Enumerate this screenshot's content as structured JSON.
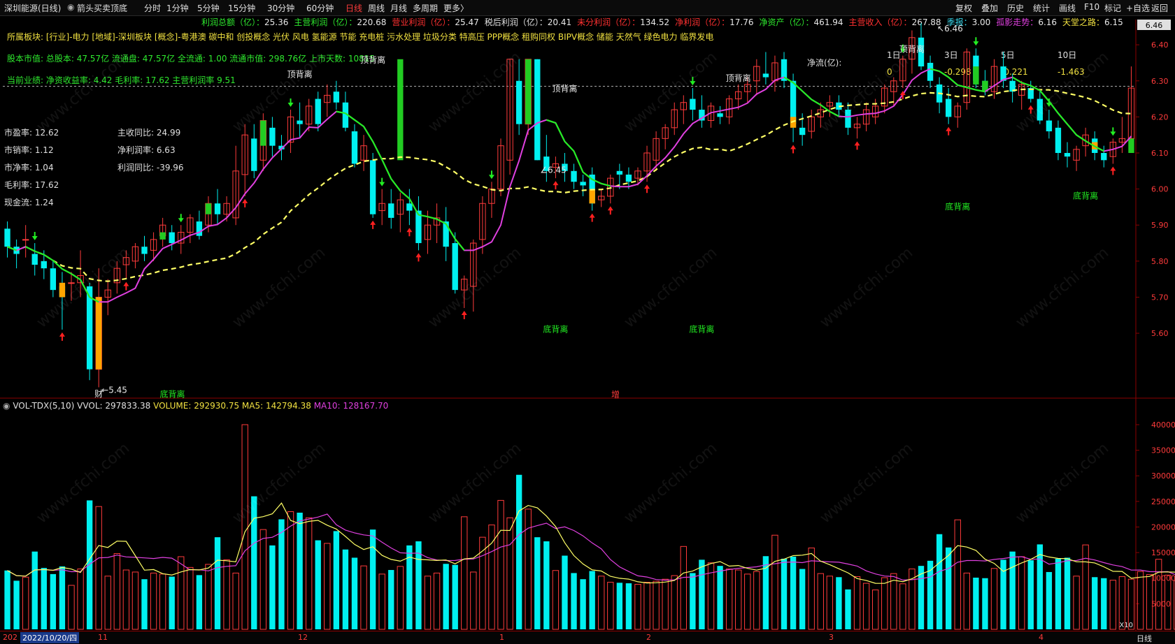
{
  "header": {
    "stock": "深圳能源(日线)",
    "indicator": "箭头买卖顶底",
    "menu": [
      "分时",
      "1分钟",
      "5分钟",
      "15分钟",
      "30分钟",
      "60分钟",
      "日线",
      "周线",
      "月线",
      "多周期",
      "更多〉"
    ],
    "active_index": 6,
    "right_buttons": [
      "复权",
      "叠加",
      "历史",
      "统计",
      "画线",
      "F10",
      "标记",
      "+自选",
      "返回"
    ]
  },
  "finance_line": [
    {
      "label": "利润总额（亿）：",
      "value": "25.36",
      "color": "#2ee82e"
    },
    {
      "label": "主营利润（亿）：",
      "value": "220.68",
      "color": "#2ee82e"
    },
    {
      "label": "营业利润（亿）：",
      "value": "25.47",
      "color": "#ff3030"
    },
    {
      "label": "税后利润（亿）：",
      "value": "20.41",
      "color": "#e0e0e0"
    },
    {
      "label": "未分利润（亿）：",
      "value": "134.52",
      "color": "#ff3030"
    },
    {
      "label": "净利润（亿）：",
      "value": "17.76",
      "color": "#ff3030"
    },
    {
      "label": "净资产（亿）：",
      "value": "461.94",
      "color": "#2ee82e"
    },
    {
      "label": "主营收入（亿）：",
      "value": "267.88",
      "color": "#ff3030"
    },
    {
      "label": "季报：",
      "value": "3.00",
      "color": "#37d4e8"
    },
    {
      "label": "孤影走势：",
      "value": "6.16",
      "color": "#e040e0"
    },
    {
      "label": "天堂之路：",
      "value": "6.15",
      "color": "#f0e040"
    }
  ],
  "sector_line": "所属板块: [行业]-电力 [地域]-深圳板块 [概念]-粤港澳 碳中和 创投概念 光伏 风电 氢能源 节能 充电桩 污水处理 垃圾分类 特高压 PPP概念 租购同权 BIPV概念 储能 天然气 绿色电力 临界发电",
  "capital_line": "股本市值: 总股本: 47.57亿 流通盘: 47.57亿 全流通: 1.00 流通市值: 298.76亿 上市天数: 10815",
  "performance_line": "当前业绩: 净资收益率: 4.42 毛利率: 17.62 主营利润率 9.51",
  "left_stats": [
    {
      "label": "市盈率: 12.62"
    },
    {
      "label": "市销率: 1.12"
    },
    {
      "label": "市净率: 1.04"
    },
    {
      "label": "毛利率: 17.62"
    },
    {
      "label": "现金流: 1.24"
    }
  ],
  "right_stats": [
    {
      "label": "主收同比: 24.99"
    },
    {
      "label": "净利润率: 6.63"
    },
    {
      "label": "利润同比: -39.96"
    }
  ],
  "netflow": {
    "title": "净流(亿):",
    "headers": [
      "1日",
      "3日",
      "5日",
      "10日"
    ],
    "values": [
      "0",
      "-0.298",
      "-0.221",
      "-1.463"
    ]
  },
  "annotations": {
    "top_div": "顶背离",
    "bottom_div": "底背离",
    "high_label": "6.46",
    "low_label": "5.45",
    "mid_label": "6.45",
    "cai_marker": "财",
    "zeng_marker": "增"
  },
  "volume_header": {
    "name": "VOL-TDX(5,10)",
    "vvol": "VVOL: 297833.38",
    "volume": "VOLUME: 292930.75",
    "ma5": "MA5: 142794.38",
    "ma10": "MA10: 128167.70"
  },
  "date_axis": {
    "current": "2022/10/20/四",
    "left_stub": "202",
    "months": [
      "11",
      "12",
      "1",
      "2",
      "3",
      "4"
    ],
    "period": "日线",
    "vol_unit": "X10"
  },
  "colors": {
    "up": "#ff3b3b",
    "down": "#00f0f0",
    "ma_short": "#e040e0",
    "ma_long": "#ffff66",
    "green_signal": "#22cc22",
    "orange_signal": "#ffa500",
    "grid": "#8b0000"
  },
  "chart_data": [
    {
      "type": "candlestick",
      "title": "深圳能源(日线)",
      "ylim": [
        5.42,
        6.47
      ],
      "y_ticks": [
        5.6,
        5.7,
        5.8,
        5.9,
        6.0,
        6.1,
        6.2,
        6.3,
        6.4
      ],
      "current_price": "6.46",
      "candles": [
        [
          5.89,
          5.91,
          5.81,
          5.84
        ],
        [
          5.84,
          5.86,
          5.78,
          5.82
        ],
        [
          5.86,
          5.9,
          5.81,
          5.86
        ],
        [
          5.82,
          5.85,
          5.76,
          5.79
        ],
        [
          5.8,
          5.83,
          5.75,
          5.78
        ],
        [
          5.78,
          5.8,
          5.7,
          5.72
        ],
        [
          5.73,
          5.77,
          5.61,
          5.7
        ],
        [
          5.74,
          5.77,
          5.69,
          5.74
        ],
        [
          5.74,
          5.83,
          5.7,
          5.76
        ],
        [
          5.73,
          5.74,
          5.47,
          5.5
        ],
        [
          5.5,
          5.78,
          5.45,
          5.7
        ],
        [
          5.7,
          5.75,
          5.65,
          5.72
        ],
        [
          5.74,
          5.8,
          5.71,
          5.78
        ],
        [
          5.79,
          5.83,
          5.75,
          5.81
        ],
        [
          5.8,
          5.85,
          5.78,
          5.84
        ],
        [
          5.84,
          5.87,
          5.8,
          5.82
        ],
        [
          5.83,
          5.88,
          5.8,
          5.86
        ],
        [
          5.87,
          5.92,
          5.84,
          5.9
        ],
        [
          5.88,
          5.9,
          5.83,
          5.85
        ],
        [
          5.85,
          5.9,
          5.82,
          5.88
        ],
        [
          5.88,
          5.93,
          5.85,
          5.92
        ],
        [
          5.91,
          5.94,
          5.86,
          5.87
        ],
        [
          5.9,
          5.98,
          5.88,
          5.96
        ],
        [
          5.96,
          6.0,
          5.9,
          5.93
        ],
        [
          5.93,
          5.98,
          5.91,
          5.96
        ],
        [
          5.92,
          6.12,
          5.9,
          6.05
        ],
        [
          6.04,
          6.18,
          5.98,
          6.15
        ],
        [
          6.14,
          6.18,
          6.03,
          6.05
        ],
        [
          6.08,
          6.21,
          6.05,
          6.19
        ],
        [
          6.17,
          6.2,
          6.09,
          6.12
        ],
        [
          6.12,
          6.15,
          6.08,
          6.11
        ],
        [
          6.13,
          6.22,
          6.1,
          6.2
        ],
        [
          6.19,
          6.24,
          6.14,
          6.18
        ],
        [
          6.18,
          6.25,
          6.16,
          6.23
        ],
        [
          6.25,
          6.27,
          6.16,
          6.18
        ],
        [
          6.24,
          6.29,
          6.2,
          6.26
        ],
        [
          6.27,
          6.3,
          6.22,
          6.24
        ],
        [
          6.24,
          6.27,
          6.16,
          6.17
        ],
        [
          6.16,
          6.18,
          6.06,
          6.07
        ],
        [
          6.08,
          6.15,
          6.05,
          6.12
        ],
        [
          6.08,
          6.1,
          5.92,
          5.93
        ],
        [
          5.94,
          6.0,
          5.9,
          5.96
        ],
        [
          5.96,
          6.0,
          5.89,
          5.92
        ],
        [
          5.93,
          5.99,
          5.88,
          5.97
        ],
        [
          5.96,
          6.0,
          5.9,
          5.94
        ],
        [
          5.94,
          5.98,
          5.83,
          5.85
        ],
        [
          5.86,
          5.94,
          5.82,
          5.9
        ],
        [
          5.9,
          5.96,
          5.85,
          5.92
        ],
        [
          5.91,
          5.95,
          5.8,
          5.84
        ],
        [
          5.85,
          5.88,
          5.71,
          5.72
        ],
        [
          5.72,
          5.76,
          5.67,
          5.75
        ],
        [
          5.73,
          5.86,
          5.66,
          5.85
        ],
        [
          5.86,
          5.98,
          5.82,
          5.96
        ],
        [
          5.96,
          6.02,
          5.92,
          6.0
        ],
        [
          6.0,
          6.14,
          5.98,
          6.12
        ],
        [
          6.08,
          6.36,
          6.04,
          6.36
        ],
        [
          6.3,
          6.36,
          6.15,
          6.18
        ],
        [
          6.18,
          6.36,
          6.15,
          6.36
        ],
        [
          6.36,
          6.36,
          6.08,
          6.08
        ],
        [
          6.09,
          6.15,
          6.02,
          6.05
        ],
        [
          6.06,
          6.09,
          6.03,
          6.07
        ],
        [
          6.07,
          6.1,
          6.02,
          6.05
        ],
        [
          6.05,
          6.07,
          6.0,
          6.02
        ],
        [
          6.02,
          6.04,
          5.98,
          6.01
        ],
        [
          6.04,
          6.06,
          5.94,
          5.96
        ],
        [
          5.97,
          6.0,
          5.95,
          5.98
        ],
        [
          5.98,
          6.04,
          5.96,
          6.03
        ],
        [
          6.05,
          6.07,
          6.0,
          6.04
        ],
        [
          6.04,
          6.06,
          6.0,
          6.02
        ],
        [
          6.03,
          6.06,
          6.01,
          6.05
        ],
        [
          6.05,
          6.12,
          6.02,
          6.1
        ],
        [
          6.08,
          6.16,
          6.05,
          6.14
        ],
        [
          6.14,
          6.18,
          6.11,
          6.17
        ],
        [
          6.17,
          6.24,
          6.15,
          6.22
        ],
        [
          6.22,
          6.26,
          6.18,
          6.24
        ],
        [
          6.25,
          6.28,
          6.19,
          6.22
        ],
        [
          6.22,
          6.26,
          6.17,
          6.19
        ],
        [
          6.19,
          6.24,
          6.17,
          6.23
        ],
        [
          6.21,
          6.23,
          6.18,
          6.2
        ],
        [
          6.2,
          6.26,
          6.18,
          6.25
        ],
        [
          6.25,
          6.29,
          6.22,
          6.27
        ],
        [
          6.27,
          6.31,
          6.24,
          6.29
        ],
        [
          6.3,
          6.36,
          6.26,
          6.34
        ],
        [
          6.32,
          6.38,
          6.29,
          6.31
        ],
        [
          6.3,
          6.37,
          6.27,
          6.35
        ],
        [
          6.36,
          6.38,
          6.28,
          6.3
        ],
        [
          6.3,
          6.32,
          6.13,
          6.18
        ],
        [
          6.17,
          6.21,
          6.12,
          6.15
        ],
        [
          6.16,
          6.22,
          6.14,
          6.2
        ],
        [
          6.2,
          6.24,
          6.17,
          6.22
        ],
        [
          6.23,
          6.26,
          6.2,
          6.24
        ],
        [
          6.24,
          6.26,
          6.2,
          6.22
        ],
        [
          6.22,
          6.24,
          6.15,
          6.17
        ],
        [
          6.17,
          6.2,
          6.14,
          6.18
        ],
        [
          6.18,
          6.24,
          6.16,
          6.22
        ],
        [
          6.2,
          6.25,
          6.18,
          6.23
        ],
        [
          6.23,
          6.29,
          6.21,
          6.28
        ],
        [
          6.27,
          6.31,
          6.23,
          6.3
        ],
        [
          6.3,
          6.37,
          6.28,
          6.36
        ],
        [
          6.36,
          6.44,
          6.32,
          6.42
        ],
        [
          6.42,
          6.46,
          6.33,
          6.34
        ],
        [
          6.35,
          6.37,
          6.28,
          6.3
        ],
        [
          6.29,
          6.31,
          6.21,
          6.24
        ],
        [
          6.25,
          6.28,
          6.18,
          6.2
        ],
        [
          6.2,
          6.24,
          6.17,
          6.23
        ],
        [
          6.24,
          6.39,
          6.22,
          6.38
        ],
        [
          6.37,
          6.39,
          6.28,
          6.3
        ],
        [
          6.3,
          6.33,
          6.26,
          6.27
        ],
        [
          6.27,
          6.36,
          6.25,
          6.34
        ],
        [
          6.34,
          6.38,
          6.28,
          6.3
        ],
        [
          6.3,
          6.32,
          6.24,
          6.27
        ],
        [
          6.26,
          6.3,
          6.22,
          6.29
        ],
        [
          6.28,
          6.3,
          6.24,
          6.25
        ],
        [
          6.25,
          6.27,
          6.18,
          6.19
        ],
        [
          6.19,
          6.22,
          6.14,
          6.16
        ],
        [
          6.17,
          6.19,
          6.08,
          6.1
        ],
        [
          6.1,
          6.13,
          6.06,
          6.09
        ],
        [
          6.08,
          6.12,
          6.05,
          6.11
        ],
        [
          6.12,
          6.17,
          6.09,
          6.15
        ],
        [
          6.14,
          6.16,
          6.08,
          6.1
        ],
        [
          6.1,
          6.12,
          6.06,
          6.08
        ],
        [
          6.09,
          6.14,
          6.07,
          6.13
        ],
        [
          6.13,
          6.2,
          6.1,
          6.14
        ],
        [
          6.14,
          6.34,
          6.13,
          6.28
        ]
      ]
    },
    {
      "type": "bar",
      "title": "VOL-TDX(5,10)",
      "ylim": [
        0,
        43000
      ],
      "y_ticks": [
        5000,
        10000,
        15000,
        20000,
        25000,
        30000,
        35000,
        40000
      ],
      "unit": "X10",
      "volumes": [
        11500,
        9500,
        10200,
        15200,
        12000,
        10800,
        12300,
        8600,
        11800,
        25200,
        24000,
        10400,
        14800,
        11600,
        11200,
        9800,
        11000,
        10800,
        10300,
        14200,
        12100,
        10600,
        12700,
        18000,
        13600,
        11000,
        40000,
        26000,
        19500,
        16400,
        21500,
        23000,
        22800,
        21800,
        17400,
        16800,
        19200,
        15600,
        14000,
        12400,
        19500,
        10800,
        11600,
        12300,
        16400,
        17200,
        10400,
        11000,
        12800,
        12600,
        22000,
        11200,
        18000,
        20400,
        25200,
        21800,
        30200,
        23500,
        18000,
        17200,
        11500,
        14400,
        11000,
        9800,
        11400,
        10400,
        9200,
        9100,
        9000,
        8800,
        9200,
        9400,
        9800,
        10500,
        16200,
        11000,
        13600,
        13000,
        12400,
        11800,
        11600,
        10800,
        11300,
        14300,
        18400,
        13800,
        14200,
        11800,
        15900,
        10900,
        10400,
        10200,
        7800,
        10300,
        9000,
        7700,
        10100,
        10900,
        8900,
        11800,
        12400,
        13400,
        18600,
        16000,
        21400,
        11000,
        10100,
        10000,
        11900,
        13600,
        15200,
        14200,
        13500,
        16600,
        11200,
        13800,
        14000,
        10400,
        16500,
        10200,
        10000,
        9600,
        10300,
        9800,
        11300,
        10700,
        13700,
        10600,
        9500,
        12200,
        10400,
        9500,
        29400
      ],
      "series": [
        {
          "name": "MA5",
          "color": "#ffff66",
          "values": "computed"
        },
        {
          "name": "MA10",
          "color": "#e040e0",
          "values": "computed"
        }
      ]
    }
  ]
}
